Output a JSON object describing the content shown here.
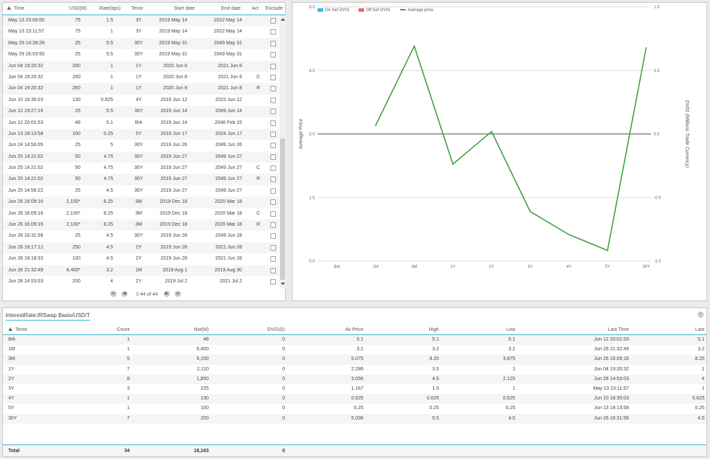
{
  "trades": {
    "columns": {
      "time": "Time",
      "usd": "USD(M)",
      "rate": "Rate(bps)",
      "tenor": "Tenor",
      "start": "Start date",
      "end": "End date",
      "act": "Act",
      "exclude": "Exclude"
    },
    "rows": [
      {
        "time": "May 13 23:09:00",
        "usd": "75",
        "rate": "1.5",
        "tenor": "3Y",
        "start": "2019 May 14",
        "end": "2022 May 14",
        "act": ""
      },
      {
        "time": "May 13 23:11:57",
        "usd": "75",
        "rate": "1",
        "tenor": "3Y",
        "start": "2019 May 14",
        "end": "2022 May 14",
        "act": ""
      },
      {
        "time": "May 29 14:28:28",
        "usd": "25",
        "rate": "5.5",
        "tenor": "30Y",
        "start": "2019 May 31",
        "end": "2049 May 31",
        "act": ""
      },
      {
        "time": "May 29 16:03:55",
        "usd": "25",
        "rate": "5.5",
        "tenor": "30Y",
        "start": "2019 May 31",
        "end": "2049 May 31",
        "act": ""
      },
      {
        "time": "Jun 04 19:20:32",
        "usd": "260",
        "rate": "1",
        "tenor": "1Y",
        "start": "2020 Jun 8",
        "end": "2021 Jun 8",
        "act": ""
      },
      {
        "time": "Jun 04 19:20:32",
        "usd": "260",
        "rate": "1",
        "tenor": "1Y",
        "start": "2020 Jun 8",
        "end": "2021 Jun 8",
        "act": "C"
      },
      {
        "time": "Jun 04 19:20:32",
        "usd": "260",
        "rate": "1",
        "tenor": "1Y",
        "start": "2020 Jun 8",
        "end": "2021 Jun 8",
        "act": "R"
      },
      {
        "time": "Jun 10 18:35:03",
        "usd": "130",
        "rate": "0.625",
        "tenor": "4Y",
        "start": "2019 Jun 12",
        "end": "2023 Jun 12",
        "act": ""
      },
      {
        "time": "Jun 12 19:27:16",
        "usd": "25",
        "rate": "5.5",
        "tenor": "30Y",
        "start": "2019 Jun 14",
        "end": "2049 Jun 14",
        "act": ""
      },
      {
        "time": "Jun 12 20:01:53",
        "usd": "48",
        "rate": "5.1",
        "tenor": "Brk",
        "start": "2019 Jun 14",
        "end": "2046 Feb 15",
        "act": ""
      },
      {
        "time": "Jun 13 18:13:58",
        "usd": "100",
        "rate": "0.25",
        "tenor": "5Y",
        "start": "2019 Jun 17",
        "end": "2024 Jun 17",
        "act": ""
      },
      {
        "time": "Jun 24 14:56:05",
        "usd": "25",
        "rate": "5",
        "tenor": "30Y",
        "start": "2019 Jun 26",
        "end": "2049 Jun 26",
        "act": ""
      },
      {
        "time": "Jun 25 14:21:02",
        "usd": "50",
        "rate": "4.75",
        "tenor": "30Y",
        "start": "2019 Jun 27",
        "end": "2049 Jun 27",
        "act": ""
      },
      {
        "time": "Jun 25 14:21:02",
        "usd": "50",
        "rate": "4.75",
        "tenor": "30Y",
        "start": "2019 Jun 27",
        "end": "2049 Jun 27",
        "act": "C"
      },
      {
        "time": "Jun 25 14:21:02",
        "usd": "50",
        "rate": "4.75",
        "tenor": "30Y",
        "start": "2019 Jun 27",
        "end": "2049 Jun 27",
        "act": "R"
      },
      {
        "time": "Jun 25 14:56:22",
        "usd": "25",
        "rate": "4.5",
        "tenor": "30Y",
        "start": "2019 Jun 27",
        "end": "2049 Jun 27",
        "act": ""
      },
      {
        "time": "Jun 26 16:09:16",
        "usd": "2,100*",
        "rate": "8.25",
        "tenor": "3M",
        "start": "2019 Dec 18",
        "end": "2020 Mar 18",
        "act": ""
      },
      {
        "time": "Jun 26 16:09:16",
        "usd": "2,100*",
        "rate": "8.25",
        "tenor": "3M",
        "start": "2019 Dec 18",
        "end": "2020 Mar 18",
        "act": "C"
      },
      {
        "time": "Jun 26 16:09:16",
        "usd": "2,100*",
        "rate": "8.25",
        "tenor": "3M",
        "start": "2019 Dec 18",
        "end": "2020 Mar 18",
        "act": "R"
      },
      {
        "time": "Jun 26 16:31:56",
        "usd": "25",
        "rate": "4.5",
        "tenor": "30Y",
        "start": "2019 Jun 28",
        "end": "2049 Jun 28",
        "act": ""
      },
      {
        "time": "Jun 26 18:17:12",
        "usd": "250",
        "rate": "4.5",
        "tenor": "2Y",
        "start": "2019 Jun 28",
        "end": "2021 Jun 28",
        "act": ""
      },
      {
        "time": "Jun 26 18:18:33",
        "usd": "100",
        "rate": "4.5",
        "tenor": "2Y",
        "start": "2019 Jun 28",
        "end": "2021 Jun 28",
        "act": ""
      },
      {
        "time": "Jun 26 21:32:49",
        "usd": "6,400*",
        "rate": "3.2",
        "tenor": "1M",
        "start": "2019 Aug 1",
        "end": "2019 Aug 30",
        "act": ""
      },
      {
        "time": "Jun 28 14:53:03",
        "usd": "200",
        "rate": "4",
        "tenor": "2Y",
        "start": "2019 Jul 2",
        "end": "2021 Jul 2",
        "act": ""
      }
    ],
    "pager": {
      "info": "1-44 of 44",
      "first": "⏮",
      "prev": "◀",
      "next": "▶",
      "last": "⏭"
    }
  },
  "legend": {
    "on_sef": "On Sef DV01",
    "off_sef": "Off Sef DV01",
    "avg_price": "Average price",
    "colors": {
      "on_sef": "#35b4e8",
      "off_sef": "#e86a6a",
      "avg_price": "#3a9d3a"
    }
  },
  "chart_data": {
    "type": "line",
    "categories": [
      "Brk",
      "1M",
      "3M",
      "1Y",
      "2Y",
      "3Y",
      "4Y",
      "5Y",
      "30Y"
    ],
    "series": [
      {
        "name": "Average price",
        "values": [
          null,
          3.2,
          5.075,
          2.286,
          3.056,
          1.167,
          0.625,
          0.25,
          5.036
        ],
        "axis": "left",
        "color": "#3a9d3a"
      }
    ],
    "ylabel": "Average Price",
    "ylabel_right": "DV01 (Millions Trade Currency)",
    "ylim": [
      0,
      6.0
    ],
    "ylim_right": [
      -1.0,
      1.0
    ],
    "left_ticks": [
      "0.0",
      "1.5",
      "3.0",
      "4.5",
      "6.0"
    ],
    "right_ticks": [
      "-1.0",
      "-0.5",
      "0.0",
      "0.5",
      "1.0"
    ],
    "grid": true,
    "legend": "top-left"
  },
  "summary": {
    "title": "InterestRate:IRSwap Basis/USD/T",
    "collapse": "⌃",
    "columns": [
      "Tenor",
      "Count",
      "Not(M)",
      "DV01(k)",
      "Av Price",
      "High",
      "Low",
      "Last Time",
      "Last"
    ],
    "rows": [
      [
        "Brk",
        "1",
        "48",
        "0",
        "5.1",
        "5.1",
        "5.1",
        "Jun 12 20:01:53",
        "5.1"
      ],
      [
        "1M",
        "1",
        "6,400",
        "0",
        "3.2",
        "3.2",
        "3.2",
        "Jun 26 21:32:49",
        "3.2"
      ],
      [
        "3M",
        "5",
        "5,100",
        "0",
        "5.075",
        "8.25",
        "3.875",
        "Jun 26 16:09:16",
        "8.25"
      ],
      [
        "1Y",
        "7",
        "2,110",
        "0",
        "2.286",
        "3.5",
        "1",
        "Jun 04 19:20:32",
        "1"
      ],
      [
        "2Y",
        "8",
        "1,850",
        "0",
        "3.056",
        "4.5",
        "2.125",
        "Jun 28 14:53:03",
        "4"
      ],
      [
        "3Y",
        "3",
        "225",
        "0",
        "1.167",
        "1.5",
        "1",
        "May 13 23:11:57",
        "1"
      ],
      [
        "4Y",
        "1",
        "130",
        "0",
        "0.625",
        "0.625",
        "0.625",
        "Jun 10 18:35:03",
        "0.625"
      ],
      [
        "5Y",
        "1",
        "100",
        "0",
        "0.25",
        "0.25",
        "0.25",
        "Jun 13 18:13:58",
        "0.25"
      ],
      [
        "30Y",
        "7",
        "200",
        "0",
        "5.036",
        "5.5",
        "4.5",
        "Jun 26 16:31:56",
        "4.5"
      ]
    ],
    "total": {
      "label": "Total",
      "count": "34",
      "notional": "16,163",
      "dv01": "0"
    }
  }
}
